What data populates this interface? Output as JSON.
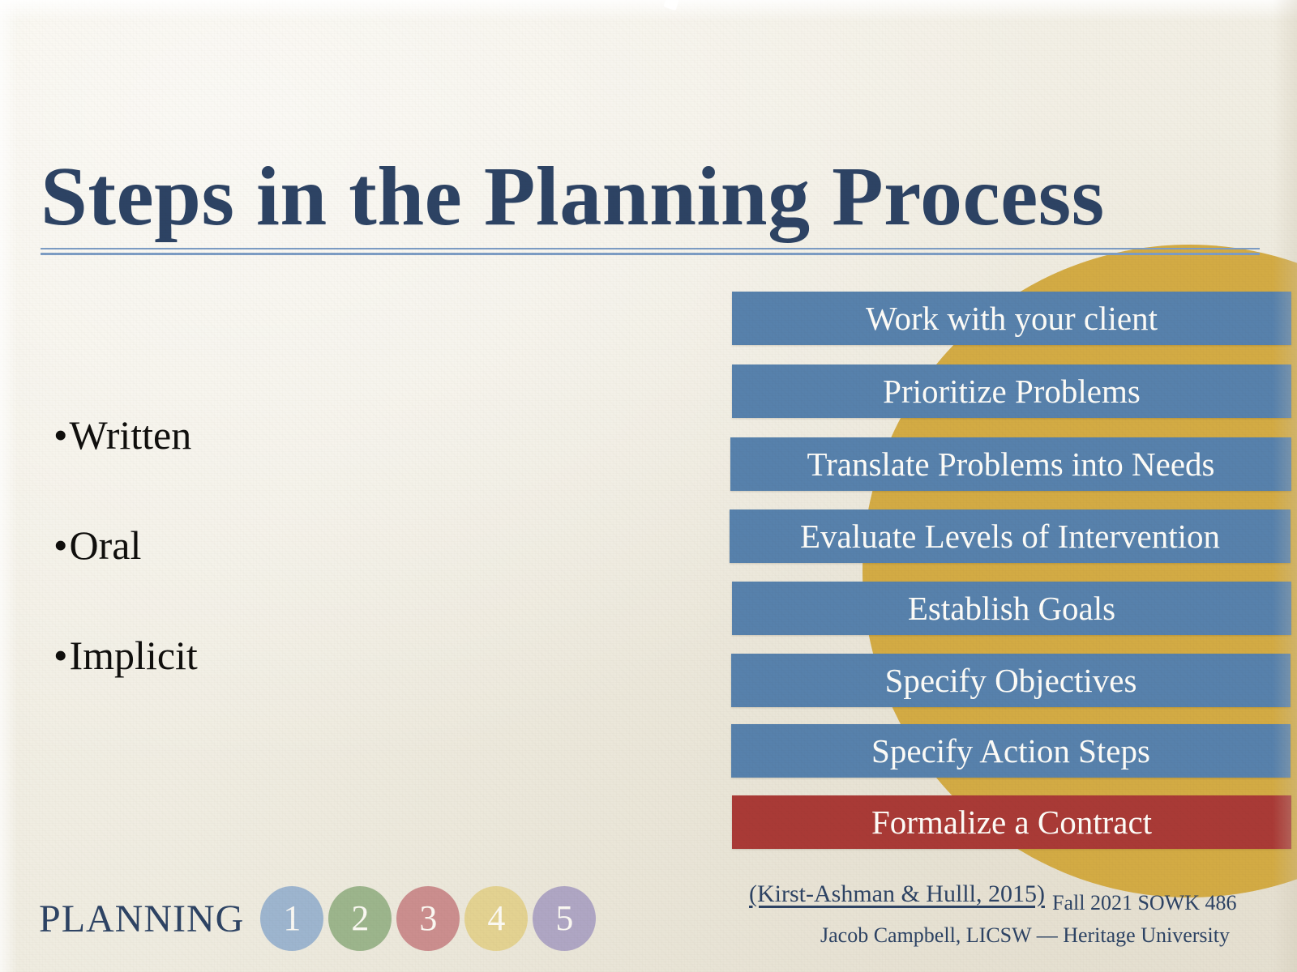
{
  "slide": {
    "title": "Steps in the Planning Process",
    "background_color": "#f1eee4",
    "title_color": "#2d4364"
  },
  "bullets": {
    "marker": "•",
    "items": [
      {
        "label": "Written"
      },
      {
        "label": "Oral"
      },
      {
        "label": "Implicit"
      }
    ]
  },
  "process": {
    "accent_circle_color": "#d3ab44",
    "bar_color": "#5781ac",
    "final_bar_color": "#a93a36",
    "steps": [
      {
        "label": "Work with your client"
      },
      {
        "label": "Prioritize Problems"
      },
      {
        "label": "Translate Problems into Needs"
      },
      {
        "label": "Evaluate Levels of Intervention"
      },
      {
        "label": "Establish Goals"
      },
      {
        "label": "Specify Objectives"
      },
      {
        "label": "Specify Action Steps"
      },
      {
        "label": "Formalize a Contract"
      }
    ]
  },
  "footer": {
    "citation": "(Kirst-Ashman & Hulll, 2015)",
    "course": "Fall 2021 SOWK 486",
    "author": "Jacob Campbell, LICSW — Heritage University",
    "planning_label": "PLANNING",
    "steps": [
      {
        "number": "1",
        "color": "#9db5cf"
      },
      {
        "number": "2",
        "color": "#9cb58c"
      },
      {
        "number": "3",
        "color": "#cb8e8e"
      },
      {
        "number": "4",
        "color": "#e3d291"
      },
      {
        "number": "5",
        "color": "#afa6c4"
      }
    ]
  }
}
